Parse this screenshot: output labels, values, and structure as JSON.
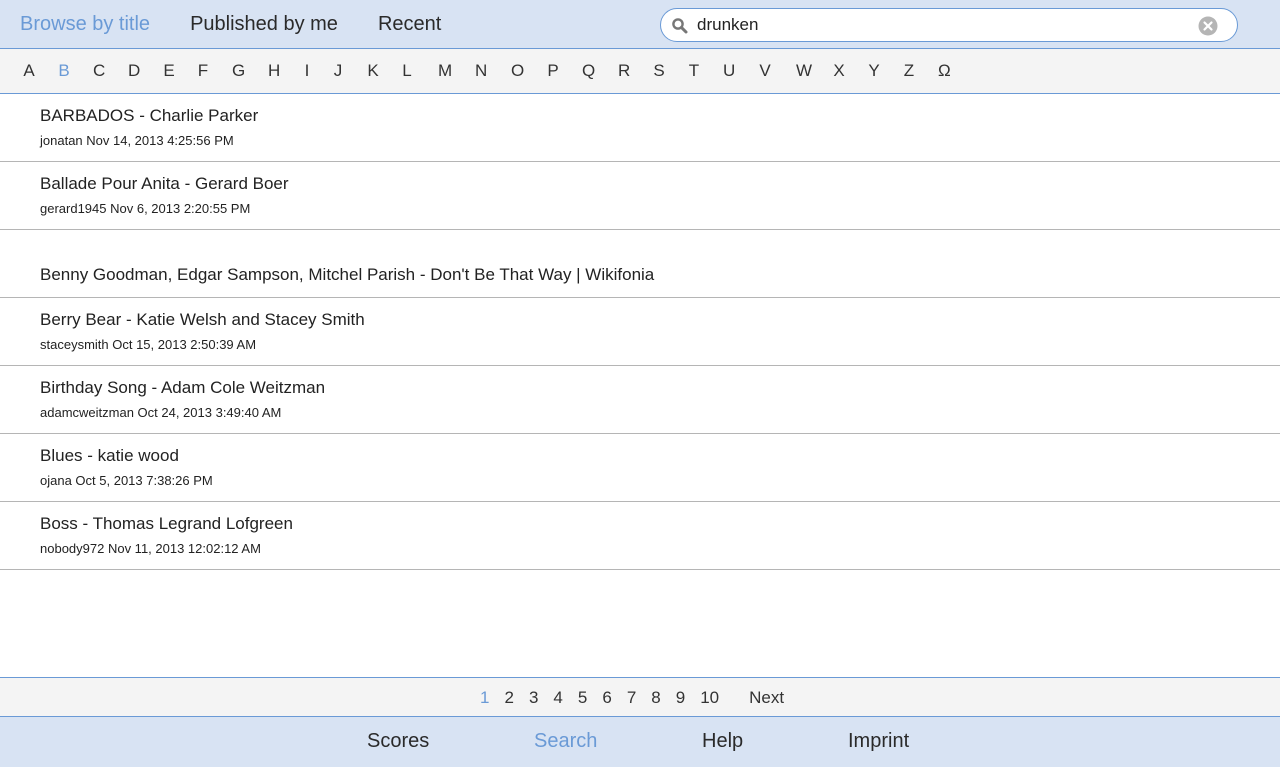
{
  "header": {
    "tabs": [
      {
        "label": "Browse by title",
        "active": true
      },
      {
        "label": "Published by me",
        "active": false
      },
      {
        "label": "Recent",
        "active": false
      }
    ],
    "search": {
      "value": "drunken",
      "icon": "search-icon",
      "clear_icon": "clear-icon"
    }
  },
  "alphabet": {
    "letters": [
      "A",
      "B",
      "C",
      "D",
      "E",
      "F",
      "G",
      "H",
      "I",
      "J",
      "K",
      "L",
      "M",
      "N",
      "O",
      "P",
      "Q",
      "R",
      "S",
      "T",
      "U",
      "V",
      "W",
      "X",
      "Y",
      "Z",
      "Ω"
    ],
    "active": "B"
  },
  "results": [
    {
      "title": "BARBADOS - Charlie Parker",
      "meta": "jonatan Nov 14, 2013 4:25:56 PM"
    },
    {
      "title": "Ballade Pour Anita - Gerard Boer",
      "meta": "gerard1945 Nov 6, 2013 2:20:55 PM"
    },
    {
      "title": "Benny Goodman, Edgar Sampson, Mitchel Parish - Don't Be That Way | Wikifonia",
      "meta": ""
    },
    {
      "title": "Berry Bear - Katie Welsh and Stacey Smith",
      "meta": "staceysmith Oct 15, 2013 2:50:39 AM"
    },
    {
      "title": "Birthday Song - Adam Cole Weitzman",
      "meta": "adamcweitzman Oct 24, 2013 3:49:40 AM"
    },
    {
      "title": "Blues - katie wood",
      "meta": "ojana Oct 5, 2013 7:38:26 PM"
    },
    {
      "title": "Boss - Thomas Legrand Lofgreen",
      "meta": "nobody972 Nov 11, 2013 12:02:12 AM"
    }
  ],
  "pagination": {
    "pages": [
      "1",
      "2",
      "3",
      "4",
      "5",
      "6",
      "7",
      "8",
      "9",
      "10"
    ],
    "current": "1",
    "next_label": "Next"
  },
  "footer": {
    "items": [
      {
        "label": "Scores",
        "active": false
      },
      {
        "label": "Search",
        "active": true
      },
      {
        "label": "Help",
        "active": false
      },
      {
        "label": "Imprint",
        "active": false
      }
    ]
  },
  "colors": {
    "accent": "#6a9ad6",
    "bar_background": "#d8e3f3",
    "subbar_background": "#f4f4f4",
    "divider": "#b5b5b5"
  }
}
